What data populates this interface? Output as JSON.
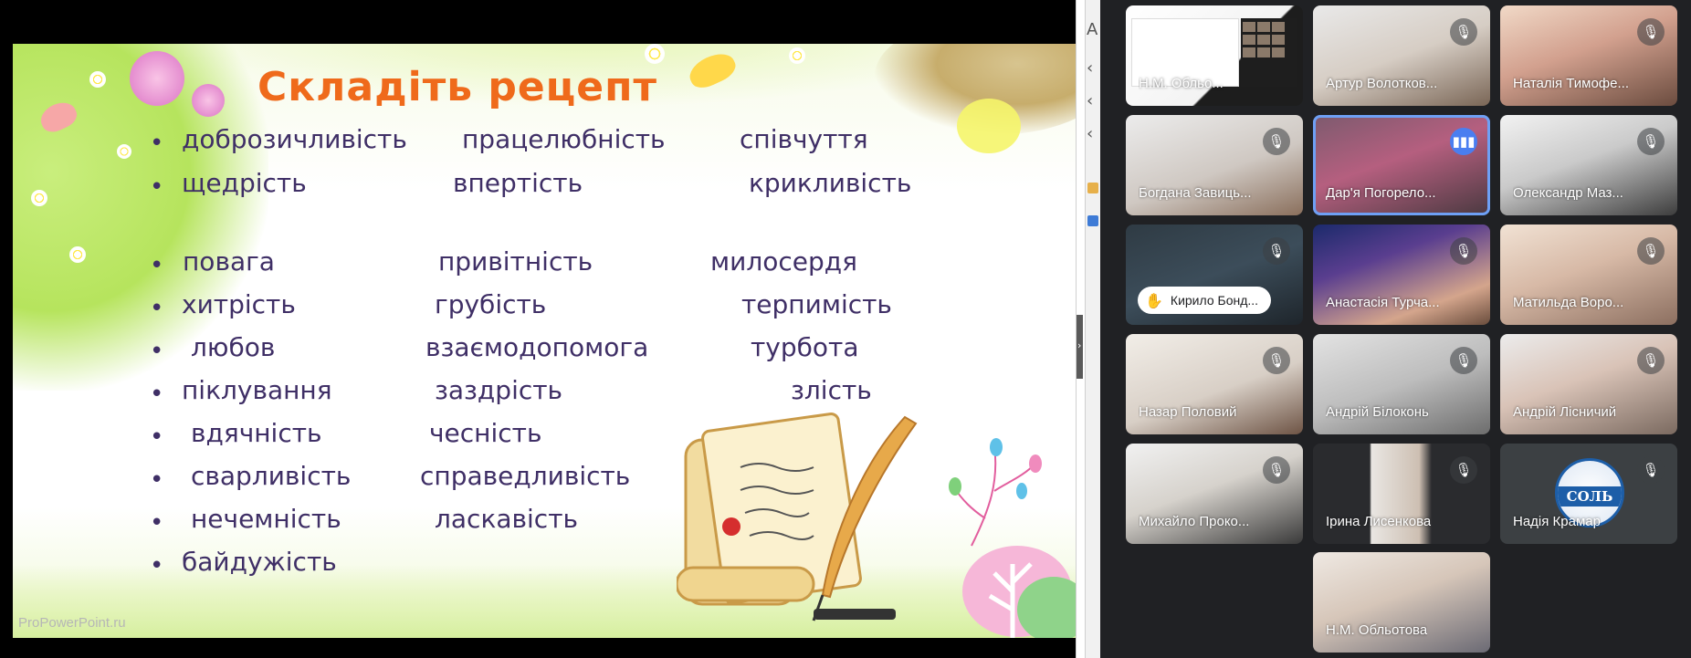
{
  "slide": {
    "title": "Складіть рецепт",
    "watermark": "ProPowerPoint.ru",
    "words": [
      "доброзичливість",
      "працелюбність",
      "співчуття",
      "щедрість",
      "впертість",
      "крикливість",
      "повага",
      "привітність",
      "милосердя",
      "хитрість",
      "грубість",
      "терпимість",
      "любов",
      "взаємодопомога",
      "турбота",
      "піклування",
      "заздрість",
      "злість",
      "вдячність",
      "чесність",
      "сварливість",
      "справедливість",
      "нечемність",
      "ласкавість",
      "байдужість"
    ]
  },
  "participants": [
    {
      "name": "Н.М. Обльо...",
      "type": "presenting"
    },
    {
      "name": "Артур Волотков...",
      "mic": "muted"
    },
    {
      "name": "Наталія Тимофе...",
      "mic": "muted"
    },
    {
      "name": "Богдана Завиць...",
      "mic": "muted"
    },
    {
      "name": "Дар'я Погорело...",
      "mic": "speaking"
    },
    {
      "name": "Олександр Маз...",
      "mic": "muted"
    },
    {
      "name": "Кирило Бонд...",
      "mic": "muted",
      "hand_raised": true
    },
    {
      "name": "Анастасія Турча...",
      "mic": "muted"
    },
    {
      "name": "Матильда Воро...",
      "mic": "muted"
    },
    {
      "name": "Назар Половий",
      "mic": "muted"
    },
    {
      "name": "Андрій Білоконь",
      "mic": "muted"
    },
    {
      "name": "Андрій Лісничий",
      "mic": "muted"
    },
    {
      "name": "Михайло Проко...",
      "mic": "muted"
    },
    {
      "name": "Ірина Лисенкова",
      "mic": "muted"
    },
    {
      "name": "Надія Крамар",
      "mic": "muted",
      "avatar_text": "СОЛЬ"
    },
    {
      "name": "Н.М. Обльотова",
      "mic": "none"
    }
  ],
  "icons": {
    "mic_muted": "mic-off-icon",
    "mic_speaking": "audio-level-icon",
    "hand": "raised-hand-icon"
  },
  "colors": {
    "title": "#ef6a1b",
    "words": "#3f2f66",
    "speaking": "#4a7ef0",
    "meet_bg": "#202124"
  }
}
